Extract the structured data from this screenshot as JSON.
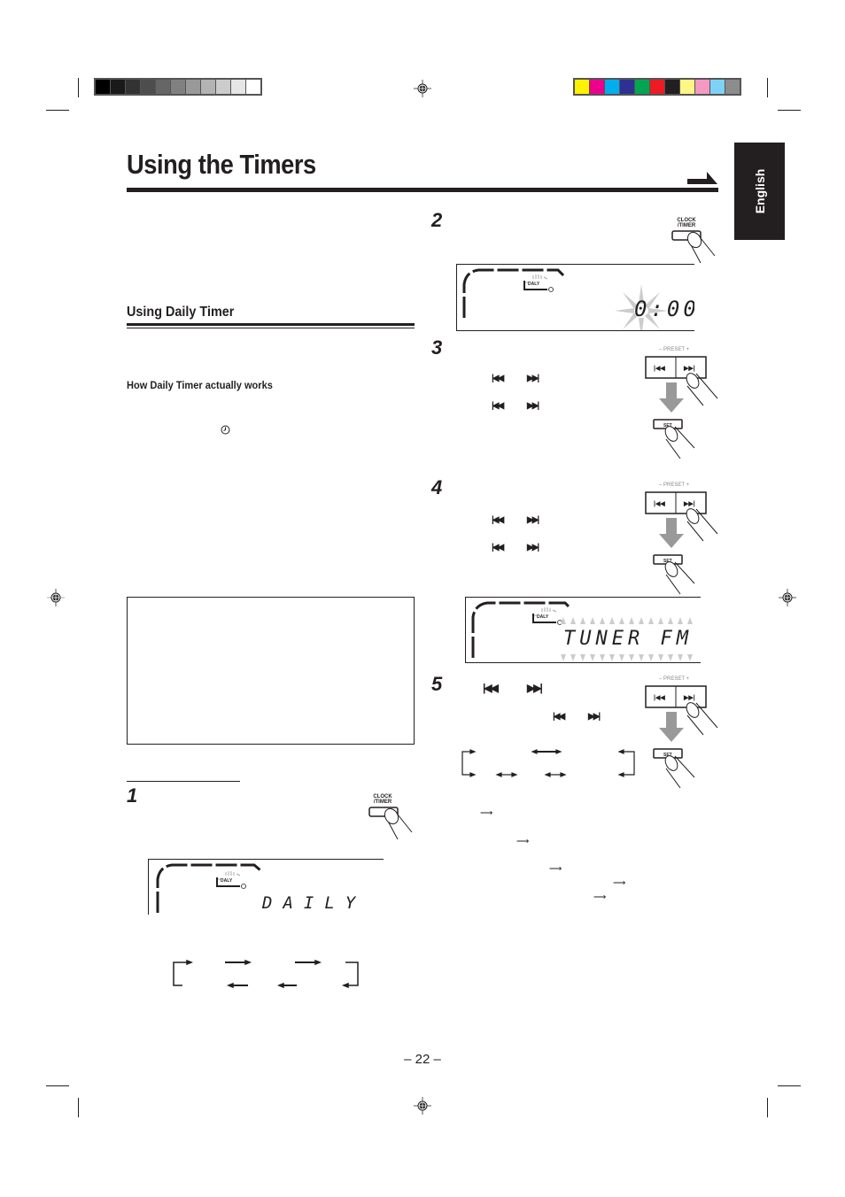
{
  "registration": {
    "gray_swatches": [
      "#000000",
      "#1a1a1a",
      "#333333",
      "#4d4d4d",
      "#666666",
      "#808080",
      "#999999",
      "#b3b3b3",
      "#cccccc",
      "#e6e6e6",
      "#ffffff"
    ],
    "color_swatches": [
      "#fff200",
      "#ec008c",
      "#00aeef",
      "#2e3192",
      "#00a651",
      "#ed1c24",
      "#231f20",
      "#fff685",
      "#f49ac2",
      "#7dd3f7",
      "#8c8c8c"
    ]
  },
  "page": {
    "title": "Using the Timers",
    "language_tab": "English",
    "page_number": "– 22 –"
  },
  "left_column": {
    "section_heading": "Using Daily Timer",
    "subheading": "How Daily Timer actually works",
    "timer_icon": "clock-timer-icon"
  },
  "steps": [
    {
      "number": "1",
      "button": {
        "line1": "CLOCK",
        "line2": "/TIMER"
      },
      "display_text": "DAILY",
      "display_indicator": "DALY"
    },
    {
      "number": "2",
      "button": {
        "line1": "CLOCK",
        "line2": "/TIMER"
      },
      "display_text": "0:00",
      "display_indicator": "DALY"
    },
    {
      "number": "3",
      "preset_label": "– PRESET +",
      "set_label": "SET"
    },
    {
      "number": "4",
      "preset_label": "– PRESET +",
      "set_label": "SET",
      "display_text": "TUNER FM",
      "display_indicator": "DALY"
    },
    {
      "number": "5",
      "preset_label": "– PRESET +",
      "set_label": "SET"
    }
  ],
  "skip_icons": {
    "prev": "◀◀",
    "next": "▶▶"
  }
}
